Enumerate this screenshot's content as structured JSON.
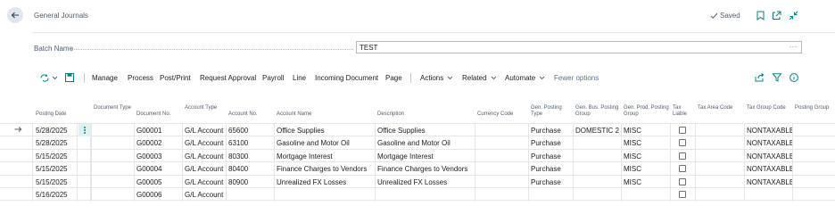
{
  "header": {
    "title": "General Journals",
    "saved_label": "Saved"
  },
  "batch": {
    "label": "Batch Name",
    "value": "TEST",
    "more": "···"
  },
  "actions": [
    {
      "id": "manage",
      "label": "Manage"
    },
    {
      "id": "process",
      "label": "Process"
    },
    {
      "id": "post-print",
      "label": "Post/Print"
    },
    {
      "id": "request-approval",
      "label": "Request Approval"
    },
    {
      "id": "payroll",
      "label": "Payroll"
    },
    {
      "id": "line",
      "label": "Line"
    },
    {
      "id": "incoming-document",
      "label": "Incoming Document"
    },
    {
      "id": "page",
      "label": "Page"
    },
    {
      "id": "actions",
      "label": "Actions"
    },
    {
      "id": "related",
      "label": "Related"
    },
    {
      "id": "automate",
      "label": "Automate"
    },
    {
      "id": "fewer-options",
      "label": "Fewer options"
    }
  ],
  "table": {
    "headers": {
      "posting_date": "Posting Date",
      "document_type": "Document Type",
      "document_no": "Document No.",
      "account_type": "Account Type",
      "account_no": "Account No.",
      "account_name": "Account Name",
      "description": "Description",
      "currency_code": "Currency Code",
      "gen_posting_type": "Gen. Posting Type",
      "gen_bus_posting_group": "Gen. Bus. Posting Group",
      "gen_prod_posting_group": "Gen. Prod. Posting Group",
      "tax_liable": "Tax Liable",
      "tax_area_code": "Tax Area Code",
      "tax_group_code": "Tax Group Code",
      "posting_group": "Posting Group"
    },
    "rows": [
      {
        "posting_date": "5/28/2025",
        "document_type": "",
        "document_no": "G00001",
        "account_type": "G/L Account",
        "account_no": "65600",
        "account_name": "Office Supplies",
        "description": "Office Supplies",
        "currency_code": "",
        "gen_posting_type": "Purchase",
        "gen_bus_posting_group": "DOMESTIC 2",
        "gen_prod_posting_group": "MISC",
        "tax_liable": false,
        "tax_area_code": "",
        "tax_group_code": "NONTAXABLE",
        "posting_group": ""
      },
      {
        "posting_date": "5/28/2025",
        "document_type": "",
        "document_no": "G00002",
        "account_type": "G/L Account",
        "account_no": "63100",
        "account_name": "Gasoline and Motor Oil",
        "description": "Gasoline and Motor Oil",
        "currency_code": "",
        "gen_posting_type": "Purchase",
        "gen_bus_posting_group": "",
        "gen_prod_posting_group": "MISC",
        "tax_liable": false,
        "tax_area_code": "",
        "tax_group_code": "NONTAXABLE",
        "posting_group": ""
      },
      {
        "posting_date": "5/15/2025",
        "document_type": "",
        "document_no": "G00003",
        "account_type": "G/L Account",
        "account_no": "80300",
        "account_name": "Mortgage Interest",
        "description": "Mortgage Interest",
        "currency_code": "",
        "gen_posting_type": "Purchase",
        "gen_bus_posting_group": "",
        "gen_prod_posting_group": "MISC",
        "tax_liable": false,
        "tax_area_code": "",
        "tax_group_code": "NONTAXABLE",
        "posting_group": ""
      },
      {
        "posting_date": "5/15/2025",
        "document_type": "",
        "document_no": "G00004",
        "account_type": "G/L Account",
        "account_no": "80400",
        "account_name": "Finance Charges to Vendors",
        "description": "Finance Charges to Vendors",
        "currency_code": "",
        "gen_posting_type": "Purchase",
        "gen_bus_posting_group": "",
        "gen_prod_posting_group": "MISC",
        "tax_liable": false,
        "tax_area_code": "",
        "tax_group_code": "NONTAXABLE",
        "posting_group": ""
      },
      {
        "posting_date": "5/15/2025",
        "document_type": "",
        "document_no": "G00005",
        "account_type": "G/L Account",
        "account_no": "80900",
        "account_name": "Unrealized FX Losses",
        "description": "Unrealized FX Losses",
        "currency_code": "",
        "gen_posting_type": "Purchase",
        "gen_bus_posting_group": "",
        "gen_prod_posting_group": "MISC",
        "tax_liable": false,
        "tax_area_code": "",
        "tax_group_code": "NONTAXABLE",
        "posting_group": ""
      },
      {
        "posting_date": "5/16/2025",
        "document_type": "",
        "document_no": "G00006",
        "account_type": "G/L Account",
        "account_no": "",
        "account_name": "",
        "description": "",
        "currency_code": "",
        "gen_posting_type": "",
        "gen_bus_posting_group": "",
        "gen_prod_posting_group": "",
        "tax_liable": false,
        "tax_area_code": "",
        "tax_group_code": "",
        "posting_group": ""
      }
    ]
  },
  "colors": {
    "accent": "#00847f",
    "muted_text": "#505c6d",
    "link_blue": "#5c6f91",
    "grid_line": "#e6e6e6",
    "selected_row_marker": "#dff2f1"
  }
}
